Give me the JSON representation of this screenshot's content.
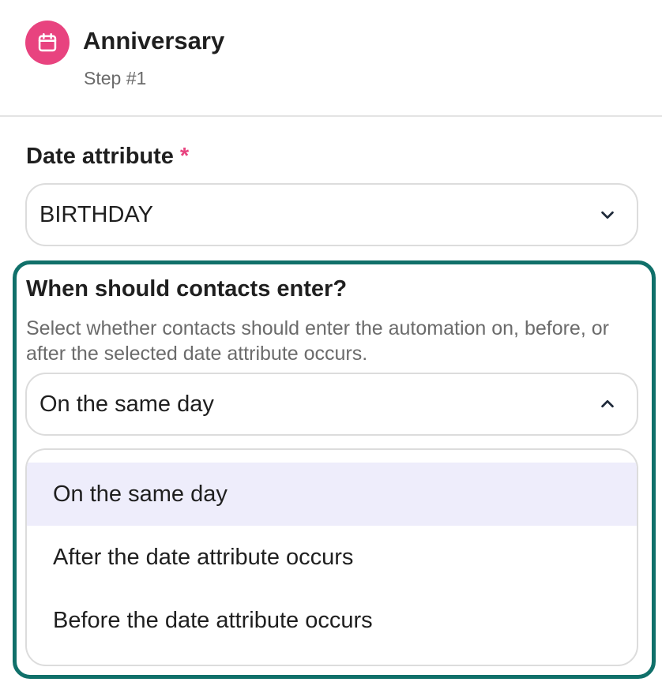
{
  "step": {
    "title": "Anniversary",
    "subtitle": "Step #1",
    "icon": "calendar-icon",
    "icon_color": "#e8437f"
  },
  "date_attribute": {
    "label": "Date attribute",
    "required_mark": "*",
    "value": "BIRTHDAY"
  },
  "entry": {
    "title": "When should contacts enter?",
    "description": "Select whether contacts should enter the automation on, before, or after the selected date attribute occurs.",
    "value": "On the same day",
    "expanded": true,
    "options": [
      {
        "label": "On the same day",
        "selected": true
      },
      {
        "label": "After the date attribute occurs",
        "selected": false
      },
      {
        "label": "Before the date attribute occurs",
        "selected": false
      }
    ]
  },
  "colors": {
    "accent_border": "#10706a",
    "selected_option_bg": "#eeedfb",
    "required": "#e8437f"
  }
}
